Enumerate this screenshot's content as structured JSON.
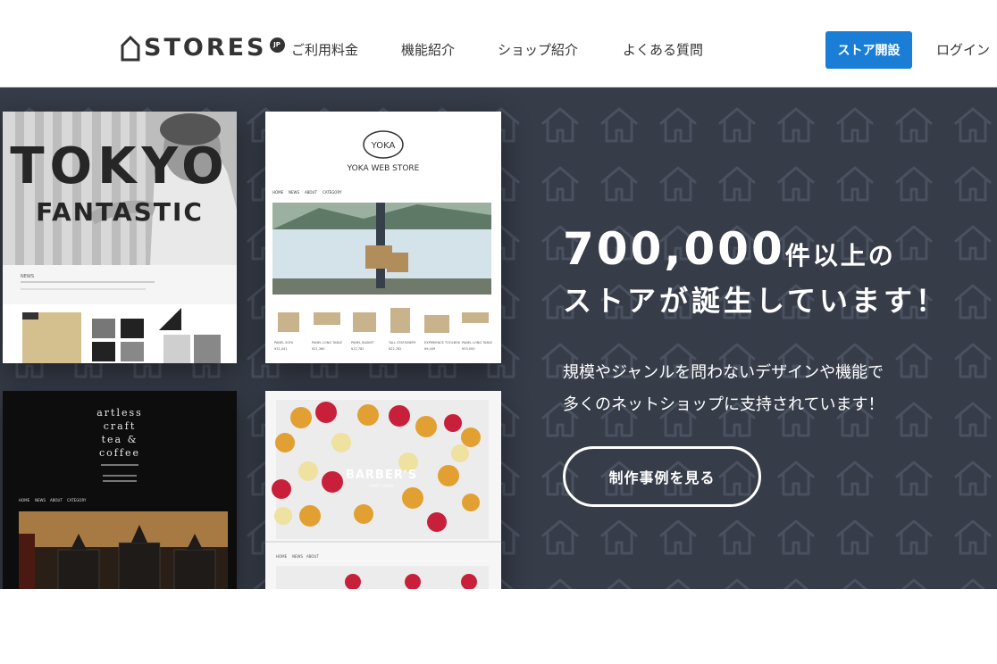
{
  "header": {
    "logo": {
      "text": "STORES",
      "badge": "JP"
    },
    "nav": [
      {
        "label": "ご利用料金"
      },
      {
        "label": "機能紹介"
      },
      {
        "label": "ショップ紹介"
      },
      {
        "label": "よくある質問"
      }
    ],
    "open_store_label": "ストア開設",
    "login_label": "ログイン",
    "accent_color": "#1a7ed6"
  },
  "hero": {
    "title_number": "700,000",
    "title_suffix": "件以上の",
    "title_line2": "ストアが誕生しています！",
    "subtitle_line1": "規模やジャンルを問わないデザインや機能で",
    "subtitle_line2": "多くのネットショップに支持されています！",
    "cases_button_label": "制作事例を見る",
    "background_color": "#363c48"
  },
  "showcase": {
    "tokyo": {
      "title1": "TOKYO",
      "title2": "FANTASTIC",
      "news_label": "NEWS"
    },
    "yoka": {
      "logo": "YOKA",
      "store_name": "YOKA WEB STORE",
      "nav": [
        "HOME",
        "NEWS",
        "ABOUT",
        "CATEGORY"
      ],
      "products": [
        {
          "name": "PANEL SOFA",
          "price": "¥31,041"
        },
        {
          "name": "PANEL LONG TABLE",
          "price": "¥21,360"
        },
        {
          "name": "PANEL BASKET",
          "price": "¥12,782"
        },
        {
          "name": "TALL STATIONERY",
          "price": "¥22,782"
        },
        {
          "name": "EXPERIENCE TOOLBOX",
          "price": "¥9,449"
        },
        {
          "name": "PANEL LONG TABLE",
          "price": "¥33,000"
        }
      ]
    },
    "artless": {
      "title": [
        "artless",
        "craft",
        "tea &",
        "coffee"
      ],
      "nav": [
        "HOME",
        "NEWS",
        "ABOUT",
        "CATEGORY"
      ]
    },
    "barbers": {
      "brand": "BARBER'S",
      "tagline": "CRAFT CANDY",
      "nav": [
        "HOME",
        "NEWS",
        "ABOUT"
      ]
    }
  }
}
